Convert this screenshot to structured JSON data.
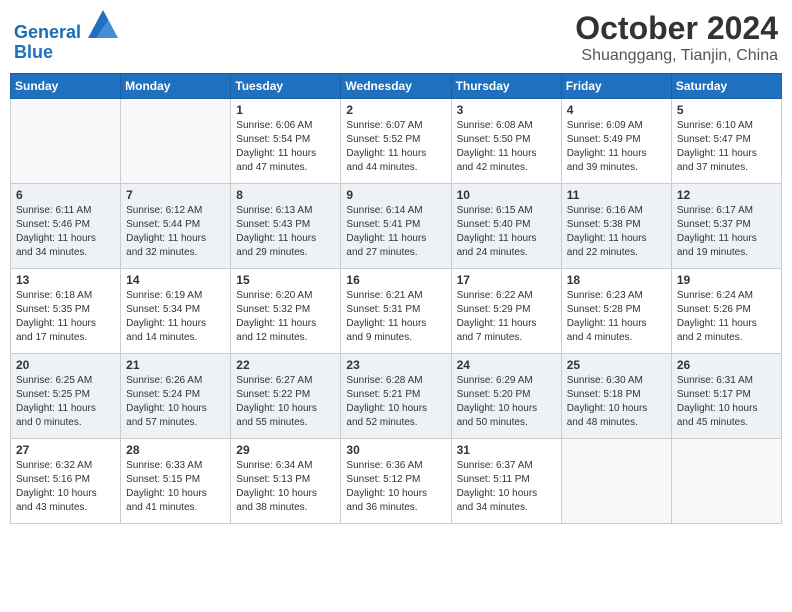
{
  "header": {
    "logo_general": "General",
    "logo_blue": "Blue",
    "month": "October 2024",
    "location": "Shuanggang, Tianjin, China"
  },
  "days_of_week": [
    "Sunday",
    "Monday",
    "Tuesday",
    "Wednesday",
    "Thursday",
    "Friday",
    "Saturday"
  ],
  "weeks": [
    [
      {
        "num": "",
        "empty": true
      },
      {
        "num": "",
        "empty": true
      },
      {
        "num": "1",
        "sunrise": "6:06 AM",
        "sunset": "5:54 PM",
        "daylight": "11 hours and 47 minutes."
      },
      {
        "num": "2",
        "sunrise": "6:07 AM",
        "sunset": "5:52 PM",
        "daylight": "11 hours and 44 minutes."
      },
      {
        "num": "3",
        "sunrise": "6:08 AM",
        "sunset": "5:50 PM",
        "daylight": "11 hours and 42 minutes."
      },
      {
        "num": "4",
        "sunrise": "6:09 AM",
        "sunset": "5:49 PM",
        "daylight": "11 hours and 39 minutes."
      },
      {
        "num": "5",
        "sunrise": "6:10 AM",
        "sunset": "5:47 PM",
        "daylight": "11 hours and 37 minutes."
      }
    ],
    [
      {
        "num": "6",
        "sunrise": "6:11 AM",
        "sunset": "5:46 PM",
        "daylight": "11 hours and 34 minutes."
      },
      {
        "num": "7",
        "sunrise": "6:12 AM",
        "sunset": "5:44 PM",
        "daylight": "11 hours and 32 minutes."
      },
      {
        "num": "8",
        "sunrise": "6:13 AM",
        "sunset": "5:43 PM",
        "daylight": "11 hours and 29 minutes."
      },
      {
        "num": "9",
        "sunrise": "6:14 AM",
        "sunset": "5:41 PM",
        "daylight": "11 hours and 27 minutes."
      },
      {
        "num": "10",
        "sunrise": "6:15 AM",
        "sunset": "5:40 PM",
        "daylight": "11 hours and 24 minutes."
      },
      {
        "num": "11",
        "sunrise": "6:16 AM",
        "sunset": "5:38 PM",
        "daylight": "11 hours and 22 minutes."
      },
      {
        "num": "12",
        "sunrise": "6:17 AM",
        "sunset": "5:37 PM",
        "daylight": "11 hours and 19 minutes."
      }
    ],
    [
      {
        "num": "13",
        "sunrise": "6:18 AM",
        "sunset": "5:35 PM",
        "daylight": "11 hours and 17 minutes."
      },
      {
        "num": "14",
        "sunrise": "6:19 AM",
        "sunset": "5:34 PM",
        "daylight": "11 hours and 14 minutes."
      },
      {
        "num": "15",
        "sunrise": "6:20 AM",
        "sunset": "5:32 PM",
        "daylight": "11 hours and 12 minutes."
      },
      {
        "num": "16",
        "sunrise": "6:21 AM",
        "sunset": "5:31 PM",
        "daylight": "11 hours and 9 minutes."
      },
      {
        "num": "17",
        "sunrise": "6:22 AM",
        "sunset": "5:29 PM",
        "daylight": "11 hours and 7 minutes."
      },
      {
        "num": "18",
        "sunrise": "6:23 AM",
        "sunset": "5:28 PM",
        "daylight": "11 hours and 4 minutes."
      },
      {
        "num": "19",
        "sunrise": "6:24 AM",
        "sunset": "5:26 PM",
        "daylight": "11 hours and 2 minutes."
      }
    ],
    [
      {
        "num": "20",
        "sunrise": "6:25 AM",
        "sunset": "5:25 PM",
        "daylight": "11 hours and 0 minutes."
      },
      {
        "num": "21",
        "sunrise": "6:26 AM",
        "sunset": "5:24 PM",
        "daylight": "10 hours and 57 minutes."
      },
      {
        "num": "22",
        "sunrise": "6:27 AM",
        "sunset": "5:22 PM",
        "daylight": "10 hours and 55 minutes."
      },
      {
        "num": "23",
        "sunrise": "6:28 AM",
        "sunset": "5:21 PM",
        "daylight": "10 hours and 52 minutes."
      },
      {
        "num": "24",
        "sunrise": "6:29 AM",
        "sunset": "5:20 PM",
        "daylight": "10 hours and 50 minutes."
      },
      {
        "num": "25",
        "sunrise": "6:30 AM",
        "sunset": "5:18 PM",
        "daylight": "10 hours and 48 minutes."
      },
      {
        "num": "26",
        "sunrise": "6:31 AM",
        "sunset": "5:17 PM",
        "daylight": "10 hours and 45 minutes."
      }
    ],
    [
      {
        "num": "27",
        "sunrise": "6:32 AM",
        "sunset": "5:16 PM",
        "daylight": "10 hours and 43 minutes."
      },
      {
        "num": "28",
        "sunrise": "6:33 AM",
        "sunset": "5:15 PM",
        "daylight": "10 hours and 41 minutes."
      },
      {
        "num": "29",
        "sunrise": "6:34 AM",
        "sunset": "5:13 PM",
        "daylight": "10 hours and 38 minutes."
      },
      {
        "num": "30",
        "sunrise": "6:36 AM",
        "sunset": "5:12 PM",
        "daylight": "10 hours and 36 minutes."
      },
      {
        "num": "31",
        "sunrise": "6:37 AM",
        "sunset": "5:11 PM",
        "daylight": "10 hours and 34 minutes."
      },
      {
        "num": "",
        "empty": true
      },
      {
        "num": "",
        "empty": true
      }
    ]
  ]
}
